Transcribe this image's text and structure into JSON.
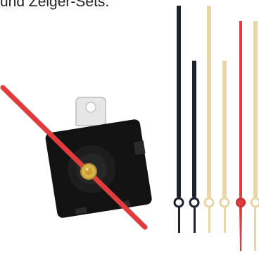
{
  "caption": "und Zeiger-Sets.",
  "colors": {
    "movement_body": "#121212",
    "hanger": "#e6e6e6",
    "second_hand_red": "#e23b3b",
    "brass": "#d8b24a",
    "hand_black": "#1c2230",
    "hand_cream": "#e8d6a8"
  },
  "icons": [
    "clock-movement",
    "clock-hand-set"
  ]
}
